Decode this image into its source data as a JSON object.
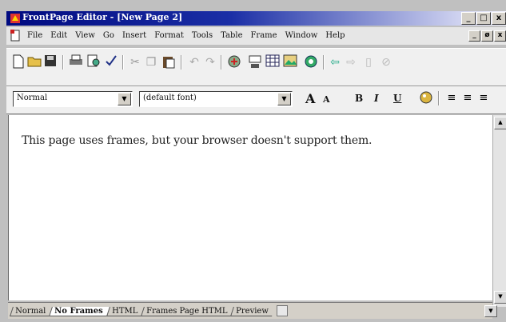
{
  "window": {
    "title": "FrontPage Editor - [New Page 2]",
    "controls": [
      "_",
      "□",
      "x"
    ]
  },
  "menubar": {
    "items": [
      "File",
      "Edit",
      "View",
      "Go",
      "Insert",
      "Format",
      "Tools",
      "Table",
      "Frame",
      "Window",
      "Help"
    ],
    "mdi_controls": [
      "_",
      "ø",
      "x"
    ]
  },
  "toolbar": {
    "icons": [
      "new-page",
      "open",
      "save",
      "print",
      "print-preview",
      "spelling",
      "cut",
      "copy",
      "paste",
      "undo",
      "redo",
      "web-bot",
      "form-field",
      "table",
      "image",
      "web-link",
      "back",
      "forward",
      "refresh",
      "stop"
    ]
  },
  "formatbar": {
    "style_value": "Normal",
    "font_value": "(default font)",
    "grow_label": "A",
    "shrink_label": "A",
    "bold_label": "B",
    "italic_label": "I",
    "underline_label": "U"
  },
  "content": {
    "message": "This page uses frames, but your browser doesn't support them."
  },
  "tabs": {
    "items": [
      "Normal",
      "No Frames",
      "HTML",
      "Frames Page HTML",
      "Preview"
    ],
    "active": "No Frames"
  }
}
